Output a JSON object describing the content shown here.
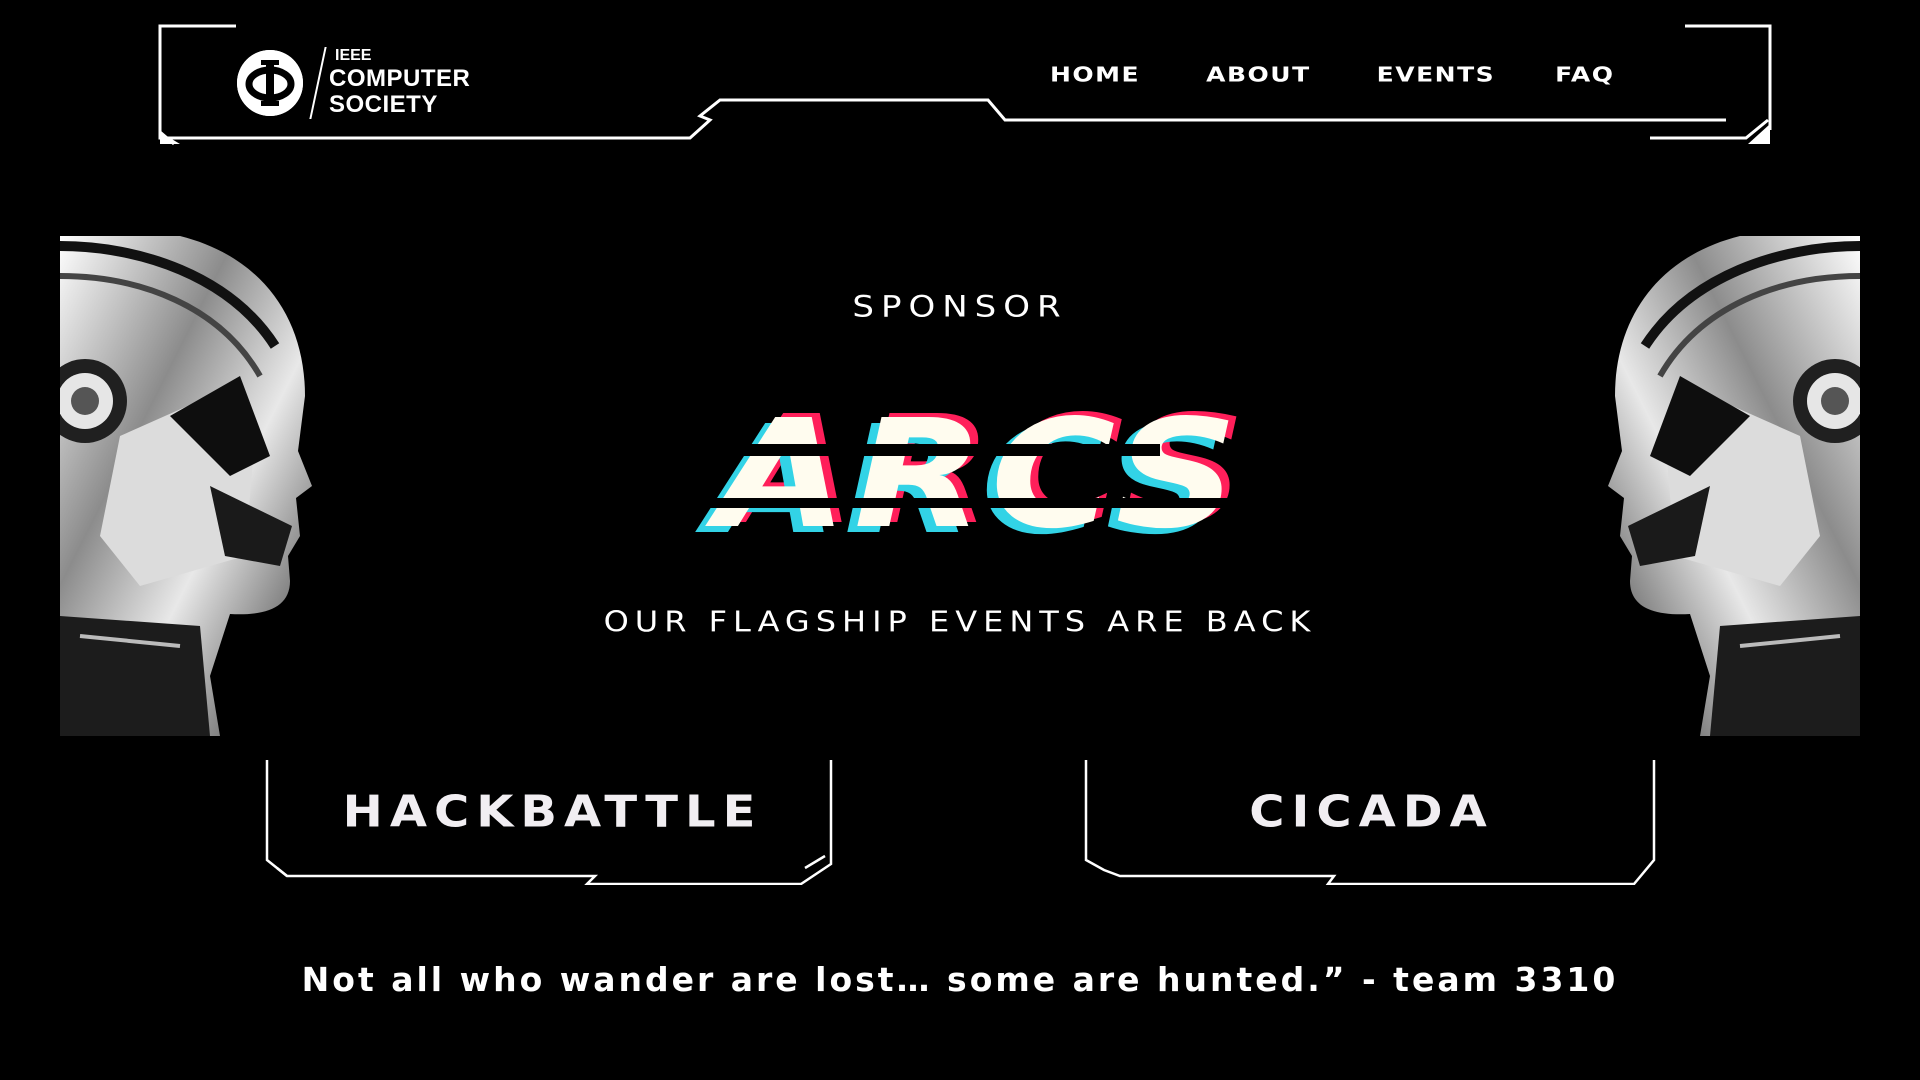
{
  "header": {
    "logo": {
      "line1": "IEEE",
      "line2": "COMPUTER",
      "line3": "SOCIETY"
    },
    "nav": {
      "home": "HOME",
      "about": "ABOUT",
      "events": "EVENTS",
      "faq": "FAQ"
    }
  },
  "hero": {
    "kicker": "SPONSOR",
    "title": "ARCS",
    "tagline": "OUR FLAGSHIP EVENTS ARE BACK"
  },
  "events": {
    "hackbattle": "HACKBATTLE",
    "cicada": "CICADA"
  },
  "quote": "Not all who wander are lost… some are hunted.” - team 3310",
  "colors": {
    "background": "#000000",
    "text": "#ffffff",
    "glitch_red": "#ff1f5a",
    "glitch_cyan": "#32d3e6",
    "title_fill": "#fffcef"
  },
  "icons": {
    "logo": "ieee-computer-society-logo-icon",
    "robot": "robot-head-icon"
  }
}
